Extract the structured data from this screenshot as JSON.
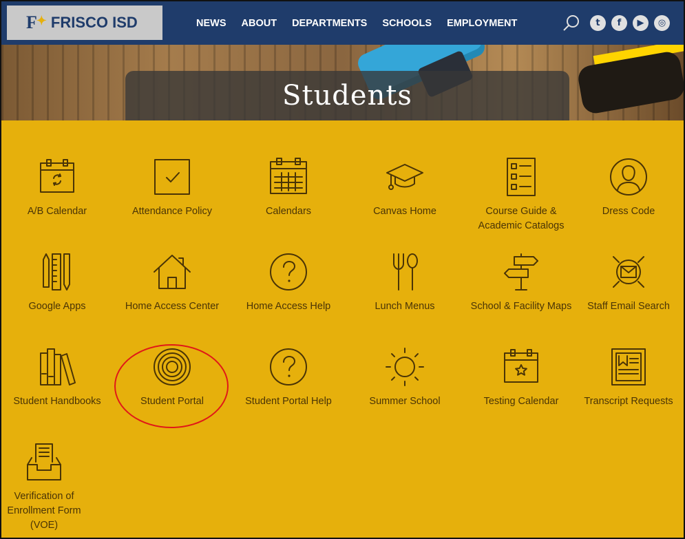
{
  "header": {
    "logo_mark": "F",
    "logo_text": "FRISCO ISD",
    "nav": [
      "NEWS",
      "ABOUT",
      "DEPARTMENTS",
      "SCHOOLS",
      "EMPLOYMENT"
    ],
    "social": [
      "twitter",
      "facebook",
      "youtube",
      "instagram"
    ]
  },
  "hero": {
    "title": "Students"
  },
  "links": [
    {
      "label": "A/B Calendar",
      "icon": "calendar-refresh-icon"
    },
    {
      "label": "Attendance Policy",
      "icon": "checkbox-icon"
    },
    {
      "label": "Calendars",
      "icon": "calendar-grid-icon"
    },
    {
      "label": "Canvas Home",
      "icon": "graduation-cap-icon"
    },
    {
      "label": "Course Guide & Academic Catalogs",
      "icon": "document-list-icon"
    },
    {
      "label": "Dress Code",
      "icon": "person-circle-icon"
    },
    {
      "label": "Google Apps",
      "icon": "ruler-pencil-icon"
    },
    {
      "label": "Home Access Center",
      "icon": "house-icon"
    },
    {
      "label": "Home Access Help",
      "icon": "question-circle-icon"
    },
    {
      "label": "Lunch Menus",
      "icon": "fork-spoon-icon"
    },
    {
      "label": "School & Facility Maps",
      "icon": "signpost-icon"
    },
    {
      "label": "Staff Email Search",
      "icon": "email-search-icon"
    },
    {
      "label": "Student Handbooks",
      "icon": "books-icon"
    },
    {
      "label": "Student Portal",
      "icon": "target-icon"
    },
    {
      "label": "Student Portal Help",
      "icon": "question-circle-icon"
    },
    {
      "label": "Summer School",
      "icon": "sun-icon"
    },
    {
      "label": "Testing Calendar",
      "icon": "calendar-star-icon"
    },
    {
      "label": "Transcript Requests",
      "icon": "document-chart-icon"
    },
    {
      "label": "Verification of Enrollment Form (VOE)",
      "icon": "inbox-document-icon"
    }
  ],
  "colors": {
    "header_bg": "#1f3c6b",
    "page_bg": "#e6b00c",
    "icon_color": "#4a3406",
    "highlight": "#e01818"
  }
}
